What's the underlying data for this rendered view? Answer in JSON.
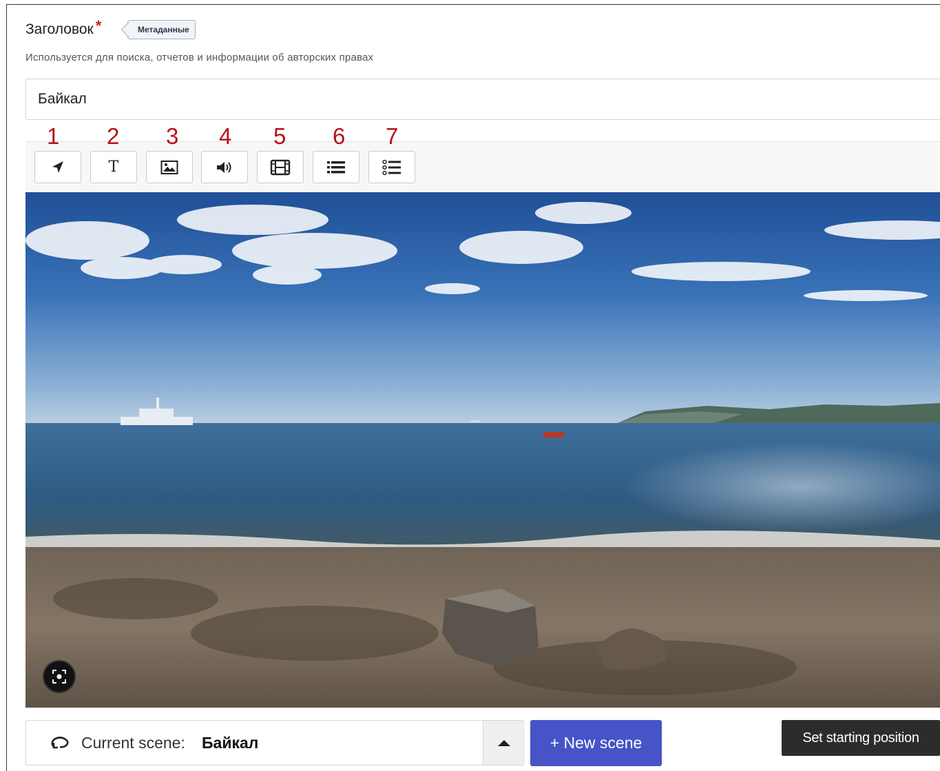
{
  "field": {
    "label": "Заголовок",
    "required_mark": "*",
    "tag": "Метаданные",
    "help": "Используется для поиска, отчетов и информации об авторских правах",
    "value": "Байкал"
  },
  "toolbar": {
    "annotations": [
      "1",
      "2",
      "3",
      "4",
      "5",
      "6",
      "7"
    ],
    "buttons": [
      {
        "icon": "navigation-arrow-icon"
      },
      {
        "icon": "text-icon"
      },
      {
        "icon": "image-icon"
      },
      {
        "icon": "audio-icon"
      },
      {
        "icon": "video-icon"
      },
      {
        "icon": "list-icon"
      },
      {
        "icon": "numbered-list-icon"
      }
    ],
    "text_icon_glyph": "T"
  },
  "scene": {
    "label": "Current scene:",
    "name": "Байкал",
    "new_button": "+ New scene",
    "set_start_button": "Set starting position"
  },
  "colors": {
    "annotation_red": "#b5121b",
    "required_red": "#c0222b",
    "primary_button": "#4654c8",
    "dark_button": "#2c2c2c"
  }
}
